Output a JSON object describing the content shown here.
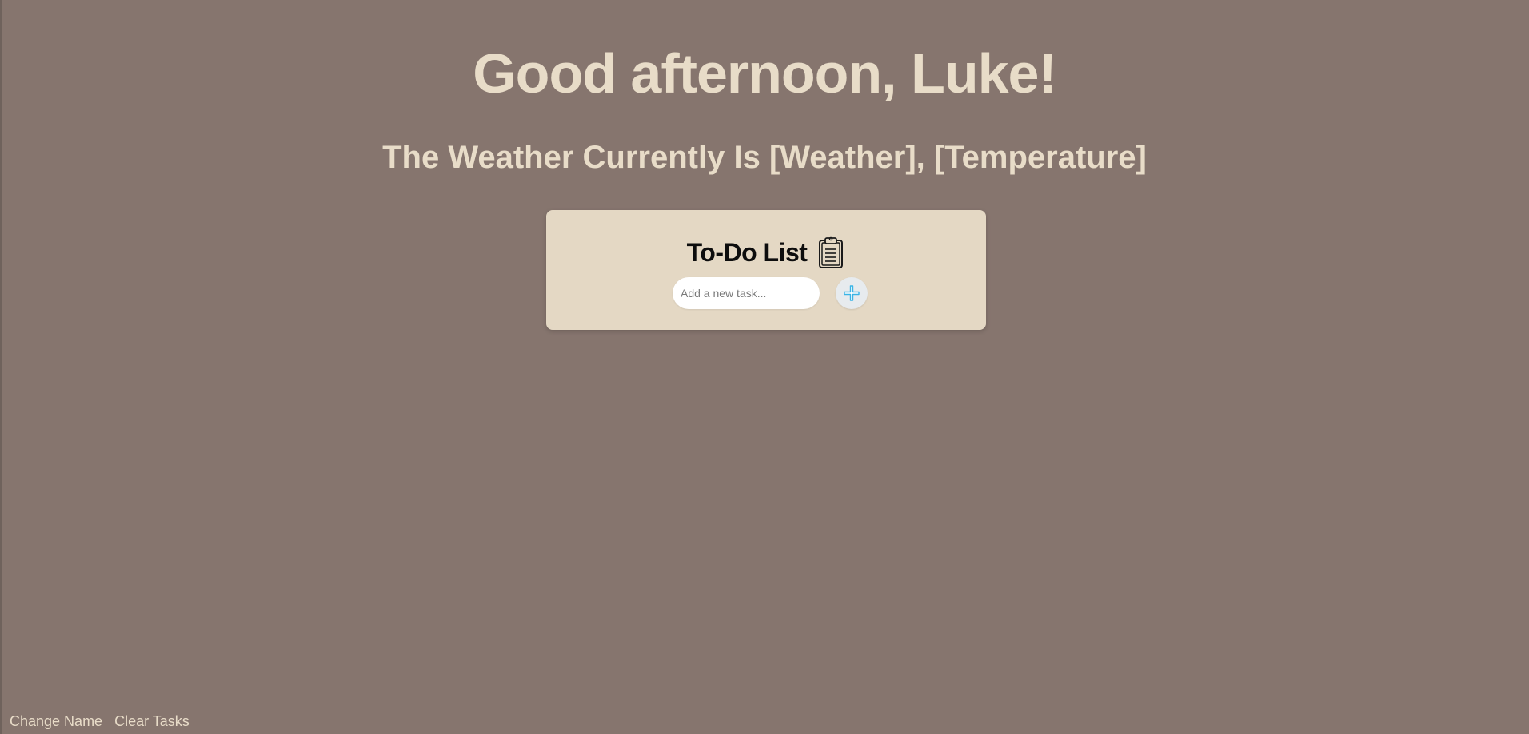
{
  "greeting": "Good afternoon, Luke!",
  "weather_line": "The Weather Currently Is [Weather], [Temperature]",
  "todo": {
    "title": "To-Do List",
    "title_icon": "clipboard-icon",
    "input_placeholder": "Add a new task...",
    "input_value": "",
    "add_button_icon": "plus-icon"
  },
  "footer": {
    "change_name": "Change Name",
    "clear_tasks": "Clear Tasks"
  },
  "colors": {
    "background": "#86756e",
    "card": "#e4d8c4",
    "text_light": "#e8dcc8",
    "accent_plus": "#3ab4e6"
  }
}
